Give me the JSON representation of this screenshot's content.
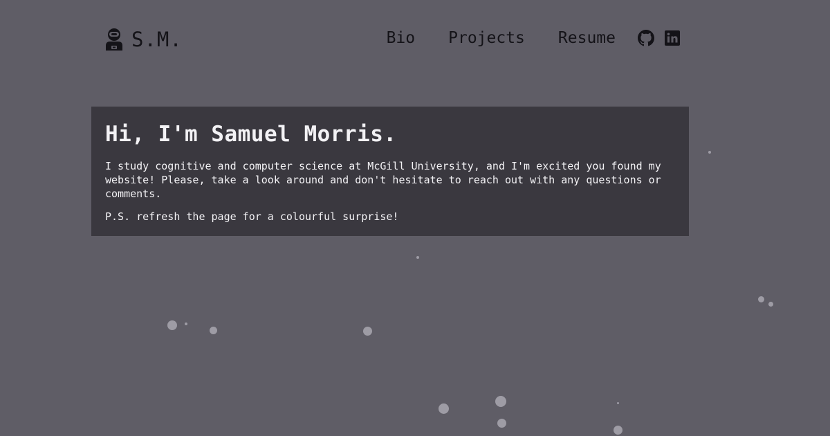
{
  "nav": {
    "logo_text": "S.M.",
    "logo_icon": "astronaut-icon",
    "links": [
      "Bio",
      "Projects",
      "Resume"
    ],
    "social": [
      "github-icon",
      "linkedin-icon"
    ]
  },
  "hero": {
    "title": "Hi, I'm Samuel Morris.",
    "intro": "I study cognitive and computer science at McGill University, and I'm excited you found my website! Please, take a look around and don't hesitate to reach out with any questions or comments.",
    "ps": "P.S. refresh the page for a colourful surprise!"
  },
  "colors": {
    "background": "#5f5d66",
    "card": "#3a383f",
    "text_dark": "#141318",
    "text_light": "#f3f2f5",
    "particle": "#9e9ca5"
  }
}
